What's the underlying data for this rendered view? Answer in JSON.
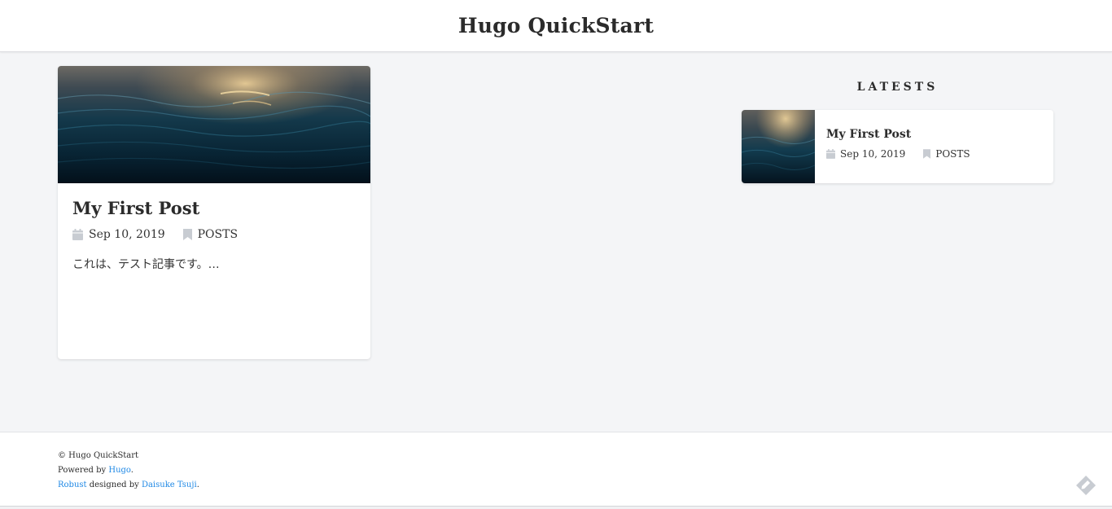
{
  "site": {
    "title": "Hugo QuickStart"
  },
  "post": {
    "title": "My First Post",
    "date": "Sep 10, 2019",
    "category": "POSTS",
    "excerpt": "これは、テスト記事です。…"
  },
  "sidebar": {
    "heading": "LATESTS",
    "items": [
      {
        "title": "My First Post",
        "date": "Sep 10, 2019",
        "category": "POSTS"
      }
    ]
  },
  "footer": {
    "copyright": "© Hugo QuickStart",
    "powered_prefix": "Powered by ",
    "powered_link": "Hugo",
    "powered_suffix": ".",
    "theme_link": "Robust",
    "designed_by": " designed by ",
    "author_link": "Daisuke Tsuji",
    "author_suffix": "."
  },
  "colors": {
    "background": "#f4f5f7",
    "link": "#1e88e5",
    "icon": "#c8ccd2"
  },
  "icons": {
    "date": "calendar-icon",
    "category": "bookmark-icon",
    "footer": "pencil-tag-icon"
  }
}
